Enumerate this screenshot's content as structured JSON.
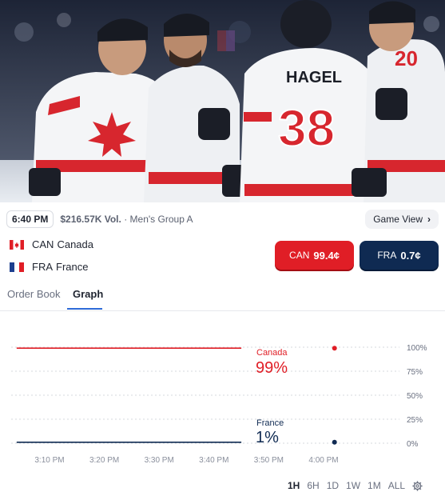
{
  "header": {
    "time": "6:40 PM",
    "volume": "$216.57K Vol.",
    "separator": "·",
    "league": "Men's Group A",
    "game_view_label": "Game View",
    "game_view_chevron": "›"
  },
  "teams": [
    {
      "abbr": "CAN",
      "name": "Canada",
      "flag": "canada-flag-icon"
    },
    {
      "abbr": "FRA",
      "name": "France",
      "flag": "france-flag-icon"
    }
  ],
  "buttons": {
    "can": {
      "label": "CAN",
      "price": "99.4¢"
    },
    "fra": {
      "label": "FRA",
      "price": "0.7¢"
    }
  },
  "tabs": [
    {
      "label": "Order Book",
      "active": false
    },
    {
      "label": "Graph",
      "active": true
    }
  ],
  "colors": {
    "canada": "#e01e26",
    "france": "#0f2a52",
    "accent": "#2e6bd8"
  },
  "chart_data": {
    "type": "line",
    "x_ticks": [
      "3:10 PM",
      "3:20 PM",
      "3:30 PM",
      "3:40 PM",
      "3:50 PM",
      "4:00 PM"
    ],
    "y_ticks": [
      "100%",
      "75%",
      "50%",
      "25%",
      "0%"
    ],
    "ylim": [
      0,
      100
    ],
    "grid": true,
    "series": [
      {
        "name": "Canada",
        "current": "99%",
        "color": "#e01e26",
        "x": [
          "3:04 PM",
          "3:45 PM"
        ],
        "y": [
          99,
          99
        ],
        "endpoint": {
          "x": "4:02 PM",
          "y": 99
        }
      },
      {
        "name": "France",
        "current": "1%",
        "color": "#0f2a52",
        "x": [
          "3:04 PM",
          "3:45 PM"
        ],
        "y": [
          1,
          1
        ],
        "endpoint": {
          "x": "4:02 PM",
          "y": 1
        }
      }
    ]
  },
  "ranges": {
    "items": [
      "1H",
      "6H",
      "1D",
      "1W",
      "1M",
      "ALL"
    ],
    "active": "1H",
    "settings_icon": "gear-icon"
  }
}
